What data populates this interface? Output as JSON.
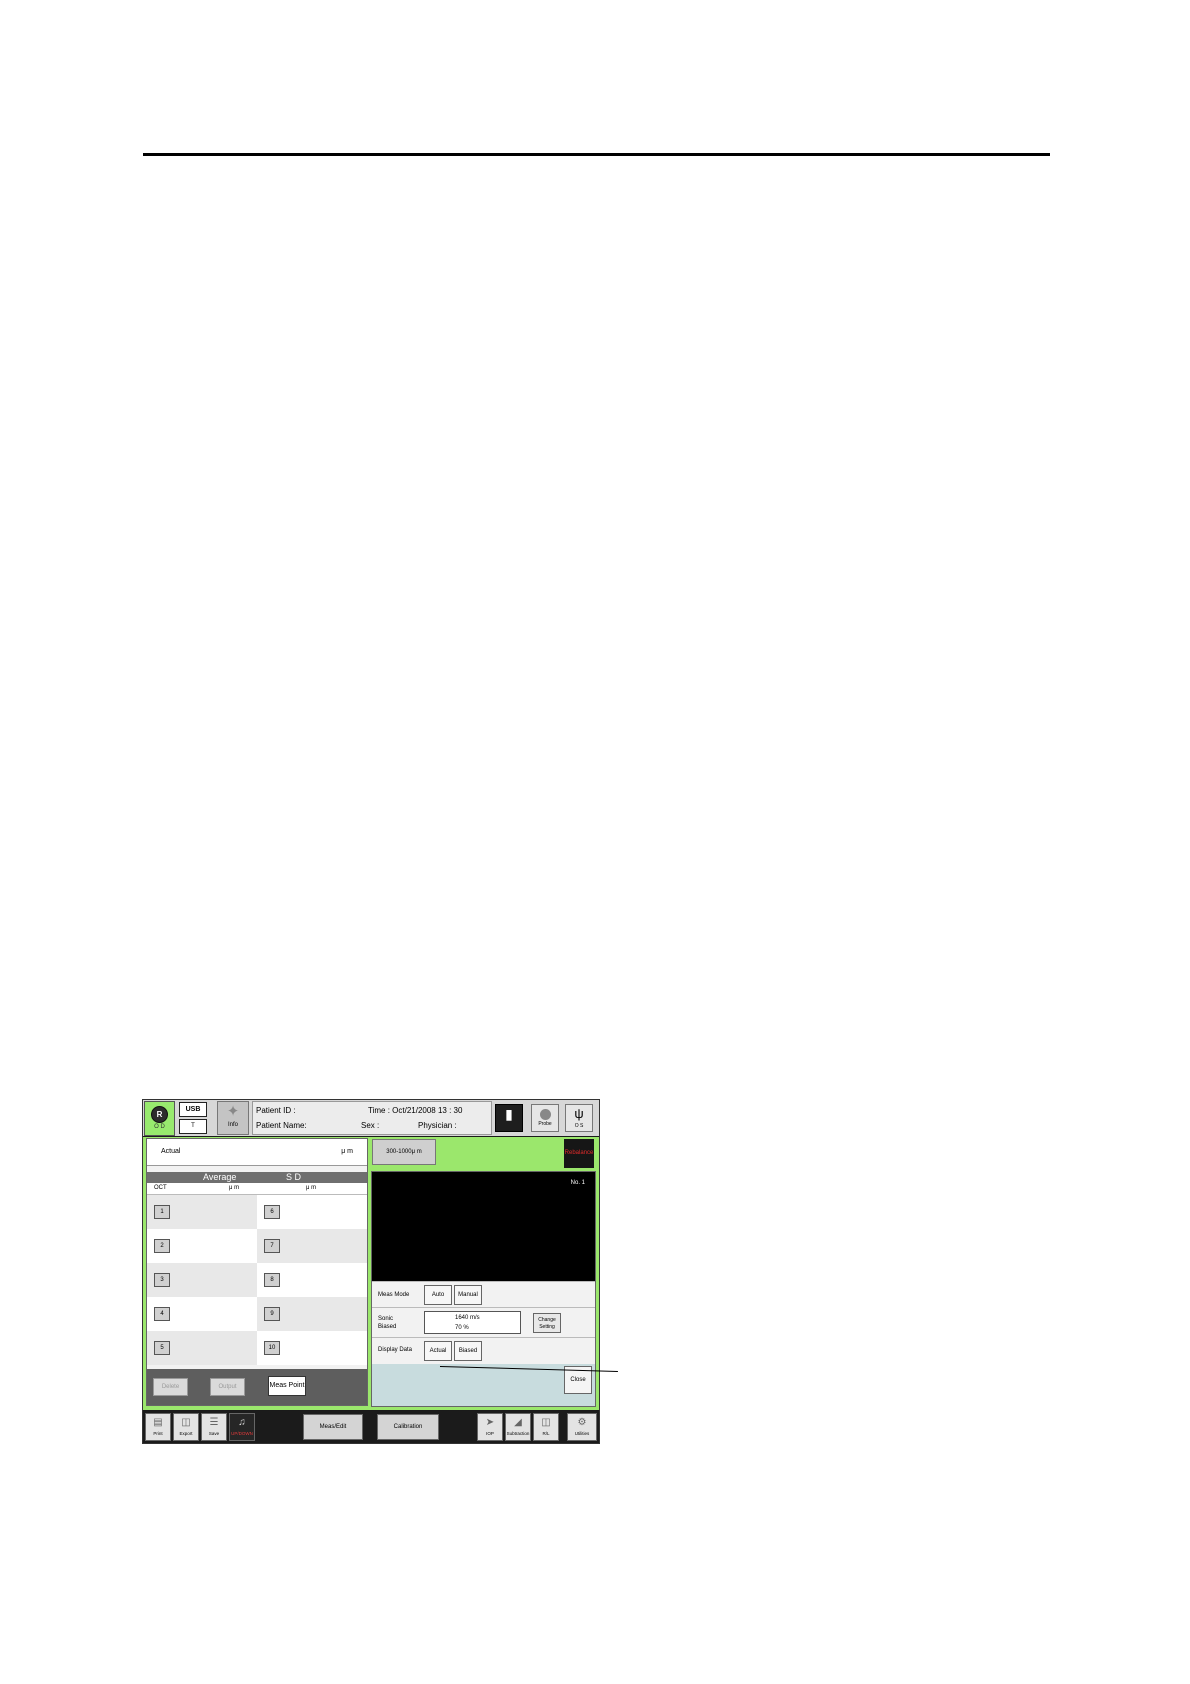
{
  "topbar": {
    "eye_left": {
      "glyph": "R",
      "label": "O D"
    },
    "usb": {
      "top": "USB",
      "bottom": "T"
    },
    "info": {
      "label": "Info"
    },
    "patient": {
      "id_label": "Patient ID :",
      "name_label": "Patient Name:",
      "time": "Time : Oct/21/2008  13 : 30",
      "sex_label": "Sex :",
      "physician_label": "Physician :"
    },
    "probe": {
      "label": "Probe"
    },
    "eye_right": {
      "label": "O S"
    }
  },
  "left_panel": {
    "actual_label": "Actual",
    "actual_unit": "μ m",
    "avg_header": "Average",
    "sd_header": "S D",
    "col_oct": "OCT",
    "col_unit_1": "μ m",
    "col_unit_2": "μ m",
    "points": [
      "1",
      "2",
      "3",
      "4",
      "5",
      "6",
      "7",
      "8",
      "9",
      "10"
    ],
    "buttons": {
      "delete": "Delete",
      "output": "Output",
      "meas_point": "Meas Point"
    }
  },
  "right_panel": {
    "range_button": "300-1000μ m",
    "rebalance_button": "Rebalance",
    "image_no": "No.  1",
    "meas_mode_label": "Meas Mode",
    "meas_mode_options": [
      "Auto",
      "Manual"
    ],
    "sonic_label": "Sonic",
    "biased_label": "Biased",
    "sonic_value": "1640  m/s",
    "biased_value": "70  %",
    "change_setting": [
      "Change",
      "Setting"
    ],
    "display_data_label": "Display Data",
    "display_data_options": [
      "Actual",
      "Biased"
    ],
    "close_button": "Close"
  },
  "toolbar": {
    "print": "Print",
    "export": "Export",
    "save": "Save",
    "updown": "UP/DOWN",
    "meas_edit": "Meas/Edit",
    "calibration": "Calibration",
    "iop": "IOP",
    "subtraction": "Subtraction",
    "rl": "R/L",
    "utilities": "Utilities"
  }
}
